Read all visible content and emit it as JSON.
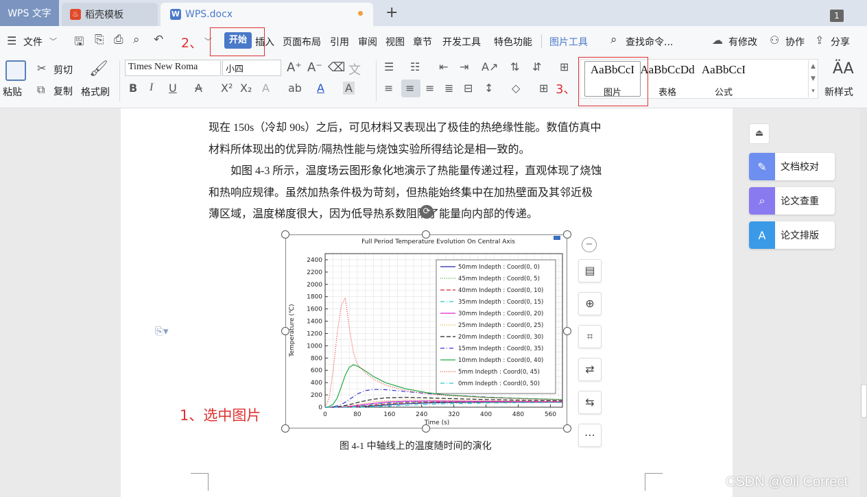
{
  "tabs": {
    "wps": "WPS 文字",
    "daoke": "稻壳模板",
    "doc": "WPS.docx",
    "new": "+",
    "window_count": "1"
  },
  "menubar": {
    "file": "文件",
    "items": [
      "开始",
      "插入",
      "页面布局",
      "引用",
      "审阅",
      "视图",
      "章节",
      "开发工具",
      "特色功能",
      "图片工具"
    ],
    "search": "查找命令...",
    "has_changes": "有修改",
    "collab": "协作",
    "share": "分享"
  },
  "ribbon": {
    "paste": "粘贴",
    "cut": "剪切",
    "copy": "复制",
    "format_painter": "格式刷",
    "font_name": "Times New Roma",
    "font_size": "小四",
    "styles": [
      {
        "sample": "AaBbCcI",
        "label": "图片"
      },
      {
        "sample": "AaBbCcDd",
        "label": "表格"
      },
      {
        "sample": "AaBbCcI",
        "label": "公式"
      }
    ],
    "new_style": "新样式"
  },
  "annotations": {
    "step1": "1、选中图片",
    "step2": "2、",
    "step3": "3、"
  },
  "document": {
    "lines": [
      "现在 150s（冷却 90s）之后，可见材料又表现出了极佳的热绝缘性能。数值仿真中",
      "材料所体现出的优异防/隔热性能与烧蚀实验所得结论是相一致的。",
      "　　如图 4-3 所示，温度场云图形象化地演示了热能量传递过程，直观体现了烧蚀",
      "和热响应规律。虽然加热条件极为苛刻，但热能始终集中在加热壁面及其邻近极",
      "薄区域，温度梯度很大，因为低导热系数阻隔了能量向内部的传递。"
    ],
    "caption": "图 4-1  中轴线上的温度随时间的演化"
  },
  "right_panel": {
    "proofread": "文档校对",
    "plagiarism": "论文查重",
    "layout": "论文排版"
  },
  "watermark": "CSDN @Oil Correct",
  "colors": {
    "accent": "#4a79c9",
    "annotation": "#e03030"
  },
  "chart_data": {
    "type": "line",
    "title": "Full Period Temperature Evolution On Central Axis",
    "xlabel": "Time (s)",
    "ylabel": "Temperature (℃)",
    "xlim": [
      0,
      590
    ],
    "ylim": [
      0,
      2500
    ],
    "xticks": [
      0,
      80,
      160,
      240,
      320,
      400,
      480,
      560
    ],
    "yticks": [
      0,
      200,
      400,
      600,
      800,
      1000,
      1200,
      1400,
      1600,
      1800,
      2000,
      2200,
      2400
    ],
    "grid": true,
    "legend_position": "top-right",
    "x": [
      0,
      10,
      20,
      30,
      40,
      50,
      60,
      70,
      80,
      100,
      120,
      150,
      200,
      250,
      300,
      400,
      500,
      590
    ],
    "series": [
      {
        "name": "50mm Indepth : Coord(0, 0)",
        "color": "#2222aa",
        "dash": "",
        "values": [
          0,
          0,
          0,
          0,
          0,
          0,
          1,
          2,
          4,
          10,
          20,
          35,
          55,
          68,
          75,
          80,
          82,
          82
        ]
      },
      {
        "name": "45mm Indepth : Coord(0, 5)",
        "color": "#22aa22",
        "dash": "1,2",
        "values": [
          0,
          0,
          0,
          0,
          0,
          1,
          2,
          4,
          7,
          15,
          28,
          45,
          65,
          75,
          80,
          83,
          84,
          84
        ]
      },
      {
        "name": "40mm Indepth : Coord(0, 10)",
        "color": "#dd2222",
        "dash": "6,3",
        "values": [
          0,
          0,
          0,
          0,
          1,
          2,
          4,
          7,
          11,
          22,
          36,
          55,
          75,
          83,
          86,
          87,
          86,
          86
        ]
      },
      {
        "name": "35mm Indepth : Coord(0, 15)",
        "color": "#22cccc",
        "dash": "6,3,1,3",
        "values": [
          0,
          0,
          0,
          1,
          2,
          4,
          8,
          12,
          18,
          32,
          48,
          68,
          86,
          92,
          93,
          91,
          89,
          88
        ]
      },
      {
        "name": "30mm Indepth : Coord(0, 20)",
        "color": "#dd22dd",
        "dash": "",
        "values": [
          0,
          0,
          1,
          2,
          4,
          8,
          14,
          20,
          28,
          45,
          62,
          82,
          98,
          101,
          100,
          96,
          92,
          90
        ]
      },
      {
        "name": "25mm Indepth : Coord(0, 25)",
        "color": "#ddaa22",
        "dash": "1,2",
        "values": [
          0,
          0,
          1,
          3,
          7,
          13,
          22,
          32,
          43,
          65,
          85,
          105,
          118,
          118,
          114,
          106,
          99,
          95
        ]
      },
      {
        "name": "20mm Indepth : Coord(0, 30)",
        "color": "#222222",
        "dash": "6,3",
        "values": [
          0,
          1,
          3,
          8,
          16,
          28,
          42,
          58,
          75,
          105,
          130,
          152,
          160,
          152,
          142,
          125,
          112,
          104
        ]
      },
      {
        "name": "15mm Indepth : Coord(0, 35)",
        "color": "#3333dd",
        "dash": "6,3,1,3",
        "values": [
          0,
          2,
          8,
          22,
          45,
          80,
          125,
          170,
          215,
          270,
          290,
          285,
          255,
          225,
          200,
          165,
          140,
          125
        ]
      },
      {
        "name": "10mm Indepth : Coord(0, 40)",
        "color": "#22aa44",
        "dash": "",
        "values": [
          0,
          10,
          50,
          150,
          330,
          520,
          650,
          690,
          670,
          590,
          500,
          400,
          300,
          240,
          200,
          160,
          140,
          125
        ]
      },
      {
        "name": "5mm Indepth : Coord(0, 45)",
        "color": "#ee3333",
        "dash": "1,2",
        "values": [
          0,
          150,
          600,
          1200,
          1650,
          1780,
          1300,
          900,
          700,
          560,
          460,
          360,
          270,
          220,
          190,
          155,
          135,
          120
        ]
      },
      {
        "name": "0mm Indepth : Coord(0, 50)",
        "color": "#22cccc",
        "dash": "6,3,1,3",
        "values": [
          0,
          0,
          0,
          0,
          0,
          0,
          0,
          0,
          1,
          3,
          7,
          15,
          30,
          45,
          56,
          68,
          74,
          77
        ]
      }
    ]
  }
}
